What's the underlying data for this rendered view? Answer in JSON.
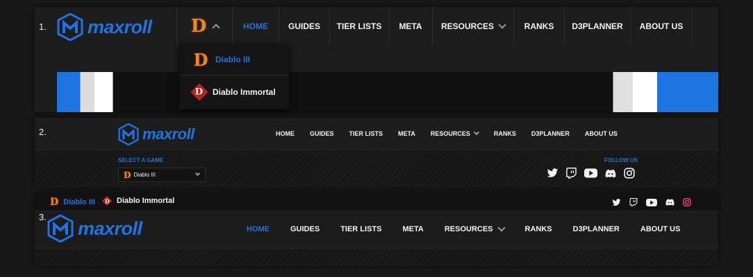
{
  "variants": [
    {
      "number": "1.",
      "logo_text": "maxroll",
      "nav": [
        "HOME",
        "GUIDES",
        "TIER LISTS",
        "META",
        "RESOURCES",
        "RANKS",
        "D3PLANNER",
        "ABOUT US"
      ],
      "active_nav": "HOME",
      "dropdown": [
        {
          "label": "Diablo III",
          "icon": "diablo-3-icon",
          "active": true
        },
        {
          "label": "Diablo Immortal",
          "icon": "diablo-immortal-icon",
          "active": false
        }
      ]
    },
    {
      "number": "2.",
      "logo_text": "maxroll",
      "nav": [
        "HOME",
        "GUIDES",
        "TIER LISTS",
        "META",
        "RESOURCES",
        "RANKS",
        "D3PLANNER",
        "ABOUT US"
      ],
      "select_label": "SELECT A GAME",
      "select_value": "Diablo III",
      "follow_label": "FOLLOW US",
      "social_icons": [
        "twitter-icon",
        "twitch-icon",
        "youtube-icon",
        "discord-icon",
        "instagram-icon"
      ]
    },
    {
      "number": "3.",
      "logo_text": "maxroll",
      "top_games": [
        {
          "label": "Diablo III",
          "icon": "diablo-3-icon",
          "active": true
        },
        {
          "label": "Diablo Immortal",
          "icon": "diablo-immortal-icon",
          "active": false
        }
      ],
      "nav": [
        "HOME",
        "GUIDES",
        "TIER LISTS",
        "META",
        "RESOURCES",
        "RANKS",
        "D3PLANNER",
        "ABOUT US"
      ],
      "active_nav": "HOME",
      "social_icons": [
        "twitter-icon",
        "twitch-icon",
        "youtube-icon",
        "discord-icon",
        "instagram-icon"
      ]
    }
  ],
  "colors": {
    "accent": "#1e74e0",
    "d3_orange": "#e88a2a",
    "immortal_red": "#b3261e",
    "bg": "#181818"
  }
}
